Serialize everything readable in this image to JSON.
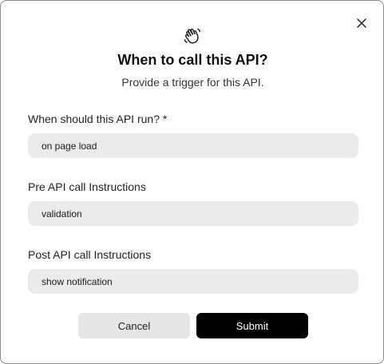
{
  "dialog": {
    "title": "When to call this API?",
    "subtitle": "Provide a trigger for this API.",
    "icon": "waving-hand-icon",
    "close_icon": "close-icon"
  },
  "fields": [
    {
      "label": "When should this API run? *",
      "value": "on page load"
    },
    {
      "label": "Pre API call Instructions",
      "value": "validation"
    },
    {
      "label": "Post API call Instructions",
      "value": "show notification"
    }
  ],
  "actions": {
    "cancel_label": "Cancel",
    "submit_label": "Submit"
  },
  "colors": {
    "input_bg": "#ebebeb",
    "submit_bg": "#000000",
    "cancel_bg": "#e6e6e6"
  }
}
